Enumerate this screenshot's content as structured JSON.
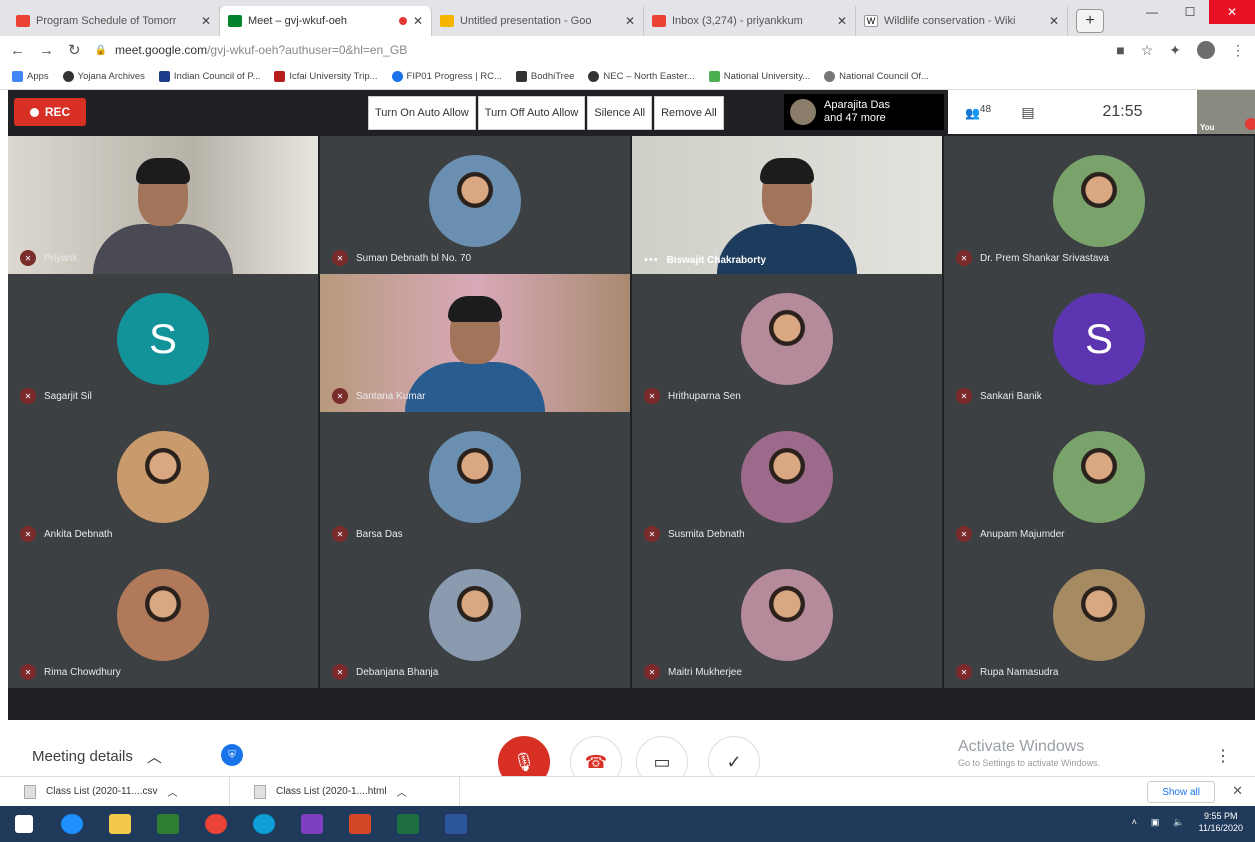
{
  "browser": {
    "tabs": [
      {
        "title": "Program Schedule of Tomorr",
        "favicon": "gmail-icon",
        "active": false
      },
      {
        "title": "Meet – gvj-wkuf-oeh",
        "favicon": "meet-icon",
        "active": true,
        "recording": true
      },
      {
        "title": "Untitled presentation - Goo",
        "favicon": "slides-icon",
        "active": false
      },
      {
        "title": "Inbox (3,274) - priyankkum",
        "favicon": "gmail-icon",
        "active": false
      },
      {
        "title": "Wildlife conservation - Wiki",
        "favicon": "wikipedia-icon",
        "active": false
      }
    ],
    "url_main": "meet.google.com",
    "url_rest": "/gvj-wkuf-oeh?authuser=0&hl=en_GB",
    "bookmarks": [
      "Apps",
      "Yojana Archives",
      "Indian Council of P...",
      "Icfai University Trip...",
      "FIP01 Progress | RC...",
      "BodhiTree",
      "NEC – North Easter...",
      "National University...",
      "National Council Of..."
    ]
  },
  "meet": {
    "rec_label": "REC",
    "control_buttons": [
      "Turn On Auto Allow",
      "Turn Off Auto Allow",
      "Silence All",
      "Remove All"
    ],
    "presenter_line1": "Aparajita Das",
    "presenter_line2": "and 47 more",
    "participant_count": "48",
    "clock": "21:55",
    "self_label": "You",
    "participants": [
      {
        "name": "Priyank",
        "type": "video"
      },
      {
        "name": "Suman Debnath bl No. 70",
        "type": "photo"
      },
      {
        "name": "Biswajit Chakraborty",
        "type": "video",
        "speaking": true
      },
      {
        "name": "Dr. Prem Shankar Srivastava",
        "type": "photo"
      },
      {
        "name": "Sagarjit Sil",
        "type": "letter",
        "letter": "S",
        "color": "#12939a"
      },
      {
        "name": "Santana Kumar",
        "type": "video"
      },
      {
        "name": "Hrithuparna Sen",
        "type": "photo"
      },
      {
        "name": "Sankari Banik",
        "type": "letter",
        "letter": "S",
        "color": "#5e35b1"
      },
      {
        "name": "Ankita Debnath",
        "type": "photo"
      },
      {
        "name": "Barsa Das",
        "type": "photo"
      },
      {
        "name": "Susmita Debnath",
        "type": "photo"
      },
      {
        "name": "Anupam Majumder",
        "type": "photo"
      },
      {
        "name": "Rima Chowdhury",
        "type": "photo"
      },
      {
        "name": "Debanjana Bhanja",
        "type": "photo"
      },
      {
        "name": "Maitri Mukherjee",
        "type": "photo"
      },
      {
        "name": "Rupa Namasudra",
        "type": "photo"
      }
    ],
    "meeting_details": "Meeting details",
    "present_label": "Activate Windows",
    "present_sub": "Go to Settings to activate Windows."
  },
  "downloads": {
    "items": [
      "Class List (2020-11....csv",
      "Class List (2020-1....html"
    ],
    "show_all": "Show all"
  },
  "taskbar": {
    "time": "9:55 PM",
    "date": "11/16/2020"
  },
  "colors": {
    "rec_red": "#d93025",
    "meet_bg": "#202124",
    "tile_bg": "#3c4043",
    "taskbar": "#1f3a5a"
  }
}
